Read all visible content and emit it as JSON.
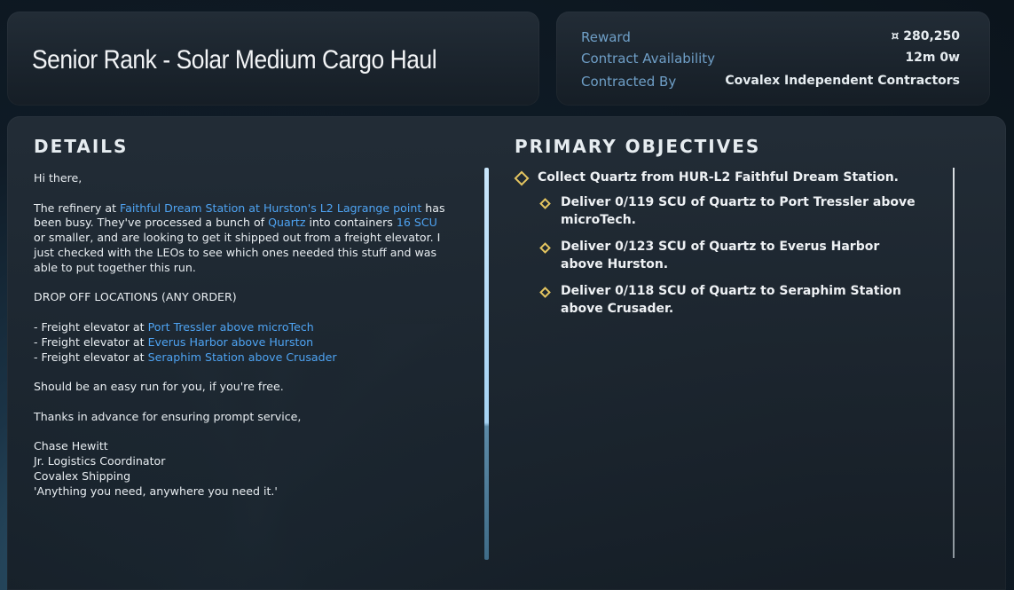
{
  "contract": {
    "title": "Senior Rank - Solar Medium Cargo Haul"
  },
  "info": {
    "reward_label": "Reward",
    "reward_value": "¤ 280,250",
    "availability_label": "Contract Availability",
    "availability_value": "12m 0w",
    "contracted_by_label": "Contracted By",
    "contracted_by_value": "Covalex Independent Contractors"
  },
  "details": {
    "heading": "DETAILS",
    "greeting": "Hi there,",
    "p1_a": "The refinery at ",
    "p1_link1": "Faithful Dream Station at Hurston's L2 Lagrange point",
    "p1_b": " has been busy. They've processed a bunch of ",
    "p1_link2": "Quartz",
    "p1_c": " into containers ",
    "p1_link3": "16 SCU",
    "p1_d": " or smaller, and are looking to get it shipped out from a freight elevator. I just checked with the LEOs to see which ones needed this stuff and was able to put together this run.",
    "dropoff_heading": "DROP OFF LOCATIONS (ANY ORDER)",
    "dropoff_prefix": "- Freight elevator at ",
    "dropoffs": [
      "Port Tressler above microTech",
      "Everus Harbor above Hurston",
      "Seraphim Station above Crusader"
    ],
    "p3": "Should be an easy run for you, if you're free.",
    "p4": "Thanks in advance for ensuring prompt service,",
    "sig_name": "Chase Hewitt",
    "sig_title": "Jr. Logistics Coordinator",
    "sig_company": "Covalex Shipping",
    "sig_motto": "'Anything you need, anywhere you need it.'"
  },
  "objectives": {
    "heading": "PRIMARY OBJECTIVES",
    "main": "Collect Quartz from HUR-L2 Faithful Dream Station.",
    "sub": [
      {
        "line1": "Deliver 0/119 SCU of Quartz to Port Tressler above",
        "line2": "microTech."
      },
      {
        "line1": "Deliver 0/123 SCU of Quartz to Everus Harbor",
        "line2": "above Hurston."
      },
      {
        "line1": "Deliver 0/118 SCU of Quartz to Seraphim Station",
        "line2": "above Crusader."
      }
    ]
  },
  "colors": {
    "link": "#4ea3f2",
    "label": "#6f9fc7",
    "objective_marker": "#e4c560"
  }
}
